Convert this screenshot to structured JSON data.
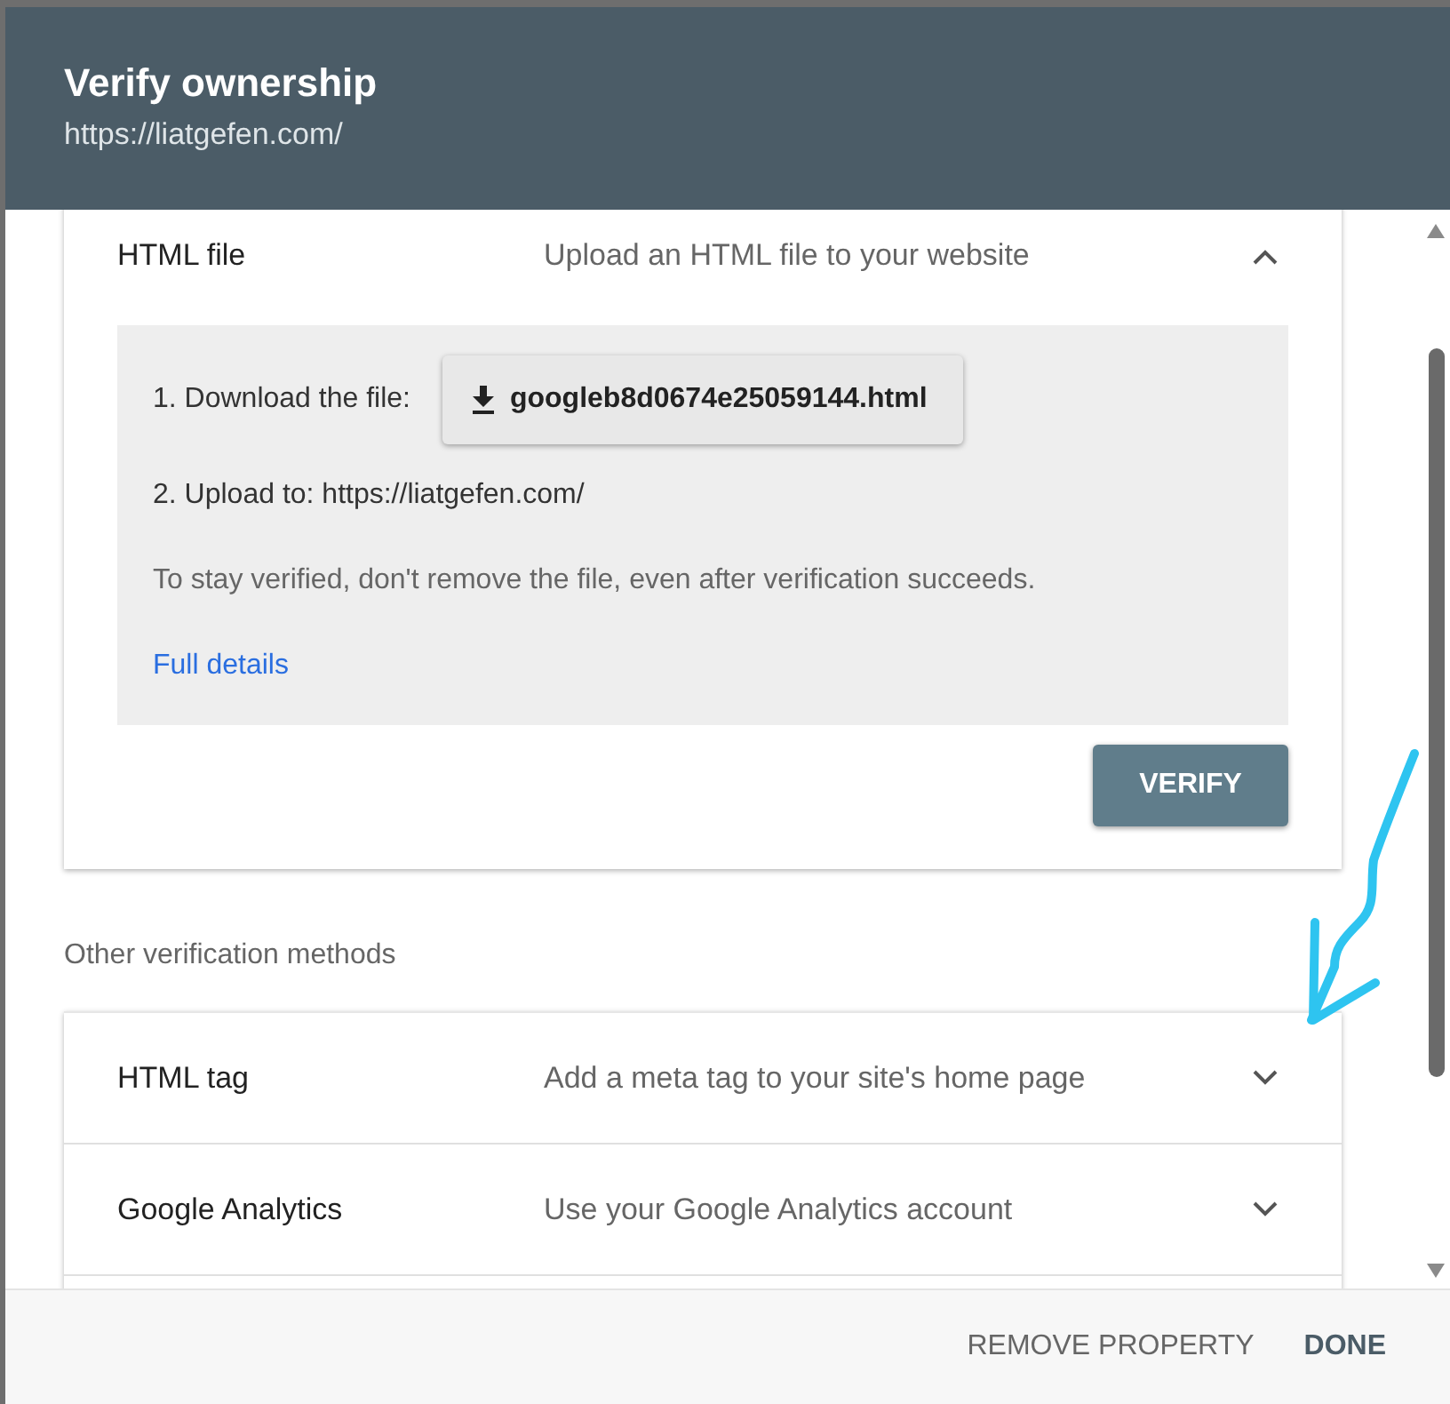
{
  "dialog": {
    "title": "Verify ownership",
    "subtitle": "https://liatgefen.com/"
  },
  "selected_method": {
    "name": "HTML file",
    "description": "Upload an HTML file to your website",
    "expanded": true,
    "steps": [
      {
        "kind": "download",
        "label": "1. Download the file:",
        "button": "googleb8d0674e25059144.html"
      },
      {
        "kind": "text",
        "label": "2. Upload to: https://liatgefen.com/"
      },
      {
        "kind": "note",
        "label": "To stay verified, don't remove the file, even after verification succeeds."
      },
      {
        "kind": "link",
        "label": "Full details"
      }
    ],
    "verify_button": "VERIFY"
  },
  "other_methods": {
    "heading": "Other verification methods",
    "items": [
      {
        "name": "HTML tag",
        "description": "Add a meta tag to your site's home page",
        "expanded": false
      },
      {
        "name": "Google Analytics",
        "description": "Use your Google Analytics account",
        "expanded": false
      }
    ]
  },
  "footer": {
    "buttons": [
      {
        "label": "REMOVE PROPERTY",
        "kind": "secondary"
      },
      {
        "label": "DONE",
        "kind": "primary"
      }
    ]
  }
}
